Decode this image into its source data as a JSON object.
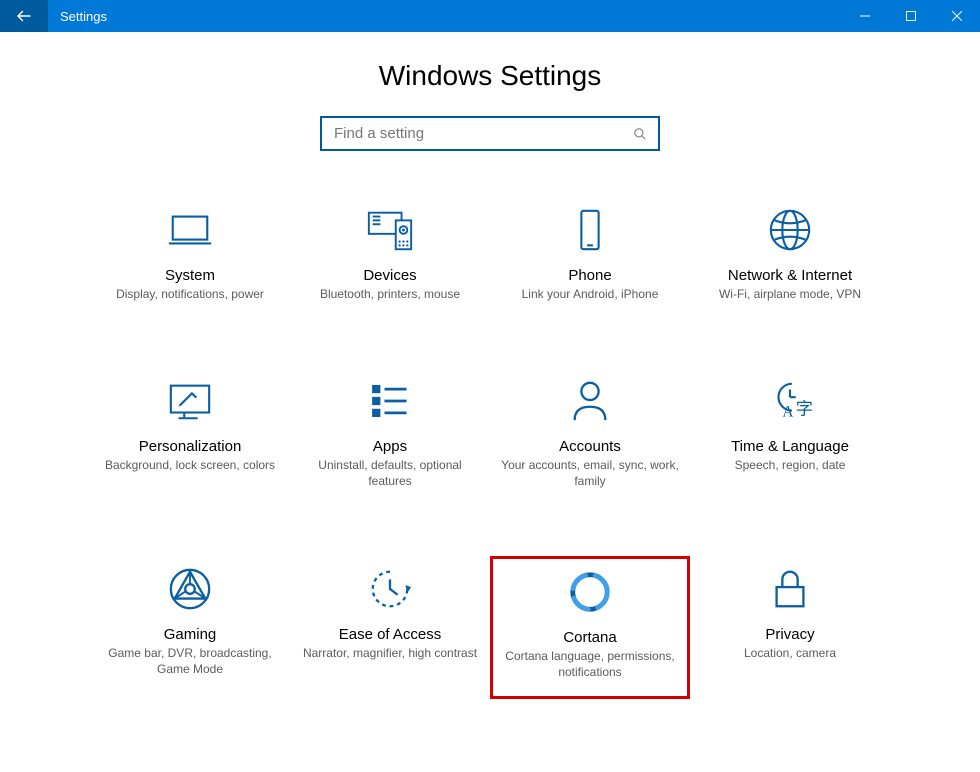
{
  "window": {
    "title": "Settings"
  },
  "page": {
    "heading": "Windows Settings"
  },
  "search": {
    "placeholder": "Find a setting"
  },
  "tiles": {
    "system": {
      "title": "System",
      "sub": "Display, notifications, power"
    },
    "devices": {
      "title": "Devices",
      "sub": "Bluetooth, printers, mouse"
    },
    "phone": {
      "title": "Phone",
      "sub": "Link your Android, iPhone"
    },
    "network": {
      "title": "Network & Internet",
      "sub": "Wi-Fi, airplane mode, VPN"
    },
    "personalization": {
      "title": "Personalization",
      "sub": "Background, lock screen, colors"
    },
    "apps": {
      "title": "Apps",
      "sub": "Uninstall, defaults, optional features"
    },
    "accounts": {
      "title": "Accounts",
      "sub": "Your accounts, email, sync, work, family"
    },
    "time": {
      "title": "Time & Language",
      "sub": "Speech, region, date"
    },
    "gaming": {
      "title": "Gaming",
      "sub": "Game bar, DVR, broadcasting, Game Mode"
    },
    "ease": {
      "title": "Ease of Access",
      "sub": "Narrator, magnifier, high contrast"
    },
    "cortana": {
      "title": "Cortana",
      "sub": "Cortana language, permissions, notifications"
    },
    "privacy": {
      "title": "Privacy",
      "sub": "Location, camera"
    }
  },
  "colors": {
    "accent": "#0078d7",
    "icon": "#0a5fa3",
    "highlight": "#d20000"
  }
}
